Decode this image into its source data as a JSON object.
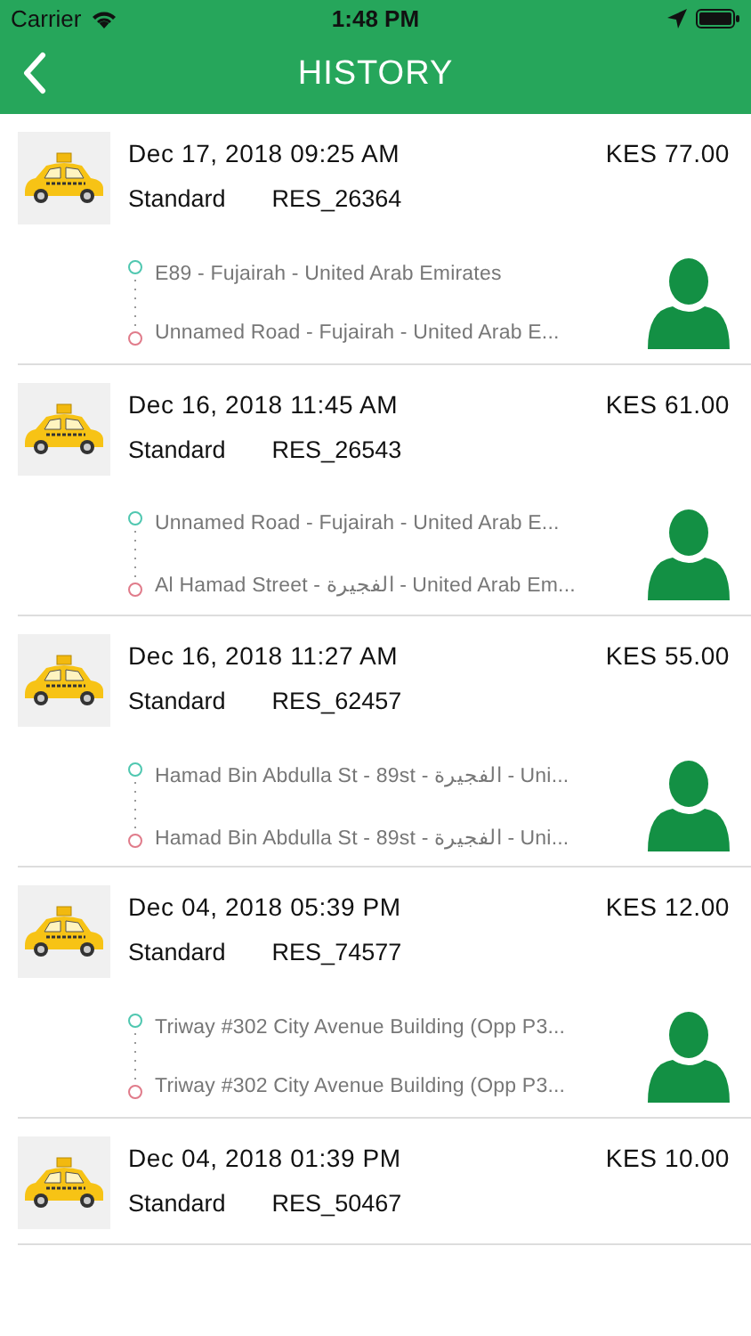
{
  "status_bar": {
    "carrier": "Carrier",
    "time": "1:48 PM"
  },
  "nav": {
    "title": "HISTORY"
  },
  "trips": [
    {
      "date": "Dec 17, 2018 09:25 AM",
      "fare": "KES 77.00",
      "type": "Standard",
      "ref": "RES_26364",
      "pickup": "E89 - Fujairah - United Arab Emirates",
      "dropoff": "Unnamed Road - Fujairah - United Arab E..."
    },
    {
      "date": "Dec 16, 2018 11:45 AM",
      "fare": "KES 61.00",
      "type": "Standard",
      "ref": "RES_26543",
      "pickup": "Unnamed Road - Fujairah - United Arab E...",
      "dropoff": "Al Hamad Street - الفجيرة - United Arab Em..."
    },
    {
      "date": "Dec 16, 2018 11:27 AM",
      "fare": "KES 55.00",
      "type": "Standard",
      "ref": "RES_62457",
      "pickup": "Hamad Bin Abdulla St - 89st - الفجيرة - Uni...",
      "dropoff": "Hamad Bin Abdulla St - 89st - الفجيرة - Uni..."
    },
    {
      "date": "Dec 04, 2018 05:39 PM",
      "fare": "KES 12.00",
      "type": "Standard",
      "ref": "RES_74577",
      "pickup": "Triway #302 City Avenue Building (Opp P3...",
      "dropoff": "Triway #302 City Avenue Building (Opp P3..."
    },
    {
      "date": "Dec 04, 2018 01:39 PM",
      "fare": "KES 10.00",
      "type": "Standard",
      "ref": "RES_50467"
    }
  ]
}
